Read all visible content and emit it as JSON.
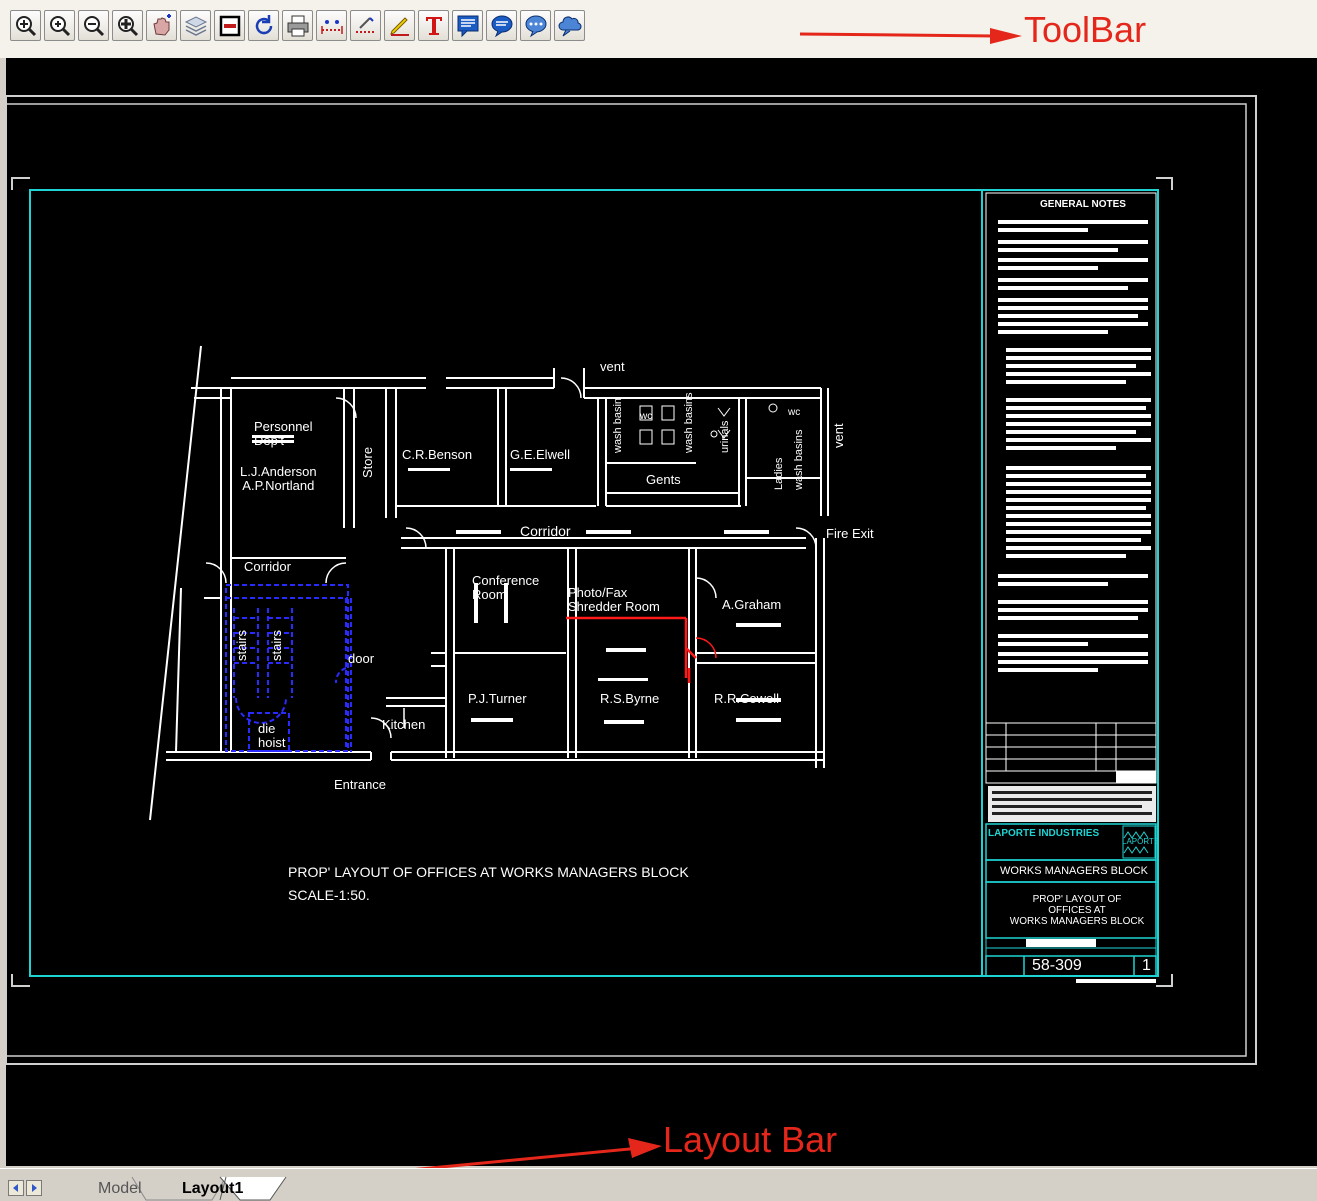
{
  "toolbar": {
    "annotation_label": "ToolBar",
    "buttons": [
      {
        "icon": "zoom-window-icon"
      },
      {
        "icon": "zoom-in-icon"
      },
      {
        "icon": "zoom-out-icon"
      },
      {
        "icon": "zoom-extents-icon"
      },
      {
        "icon": "pan-icon"
      },
      {
        "icon": "layers-icon"
      },
      {
        "icon": "frame-icon"
      },
      {
        "icon": "regen-icon"
      },
      {
        "icon": "print-icon"
      },
      {
        "icon": "measure-distance-icon"
      },
      {
        "icon": "measure-area-icon"
      },
      {
        "icon": "pen-markup-icon"
      },
      {
        "icon": "text-icon"
      },
      {
        "icon": "note-icon"
      },
      {
        "icon": "comment-icon"
      },
      {
        "icon": "callout-icon"
      },
      {
        "icon": "cloud-markup-icon"
      }
    ]
  },
  "drawing": {
    "rooms": {
      "personnel": "Personnel\nDep't",
      "personnel_names": "L.J.Anderson\nA.P.Nortland",
      "store": "Store",
      "benson": "C.R.Benson",
      "elwell": "G.E.Elwell",
      "gents": "Gents",
      "vent_top": "vent",
      "vent_right": "vent",
      "corridor_main": "Corridor",
      "fire_exit": "Fire Exit",
      "corridor_left": "Corridor",
      "conference": "Conference\nRoom",
      "photo_fax": "Photo/Fax\nShredder Room",
      "graham": "A.Graham",
      "door": "door",
      "stairs_1": "stairs",
      "stairs_2": "stairs",
      "die_hoist": "die\nhoist",
      "kitchen": "Kitchen",
      "turner": "P.J.Turner",
      "byrne": "R.S.Byrne",
      "cowell": "R.R.Cowell",
      "entrance": "Entrance",
      "urinals": "urinals",
      "wc_1": "wc",
      "wc_2": "wc",
      "wash_basins": "wash basins",
      "wash_basin_left": "wash basin",
      "ladies": "Ladies",
      "ladies_basins": "wash basins"
    },
    "caption_title": "PROP' LAYOUT OF OFFICES AT WORKS MANAGERS BLOCK",
    "caption_scale": "SCALE-1:50.",
    "title_block": {
      "general_notes": "GENERAL NOTES",
      "company": "LAPORTE INDUSTRIES",
      "company_short": "LAPORTE",
      "project": "WORKS MANAGERS BLOCK",
      "title": "PROP' LAYOUT OF\nOFFICES AT\nWORKS MANAGERS BLOCK",
      "drawing_no": "58-309",
      "revision": "1"
    }
  },
  "layout_bar": {
    "annotation_label": "Layout Bar",
    "tabs": [
      "Model",
      "Layout1"
    ],
    "active_tab": "Layout1"
  },
  "colors": {
    "annotation": "#e5271b",
    "border_cyan": "#1fd3d3",
    "stairs_blue": "#2a2aff",
    "accent_red": "#ff1a1a"
  }
}
